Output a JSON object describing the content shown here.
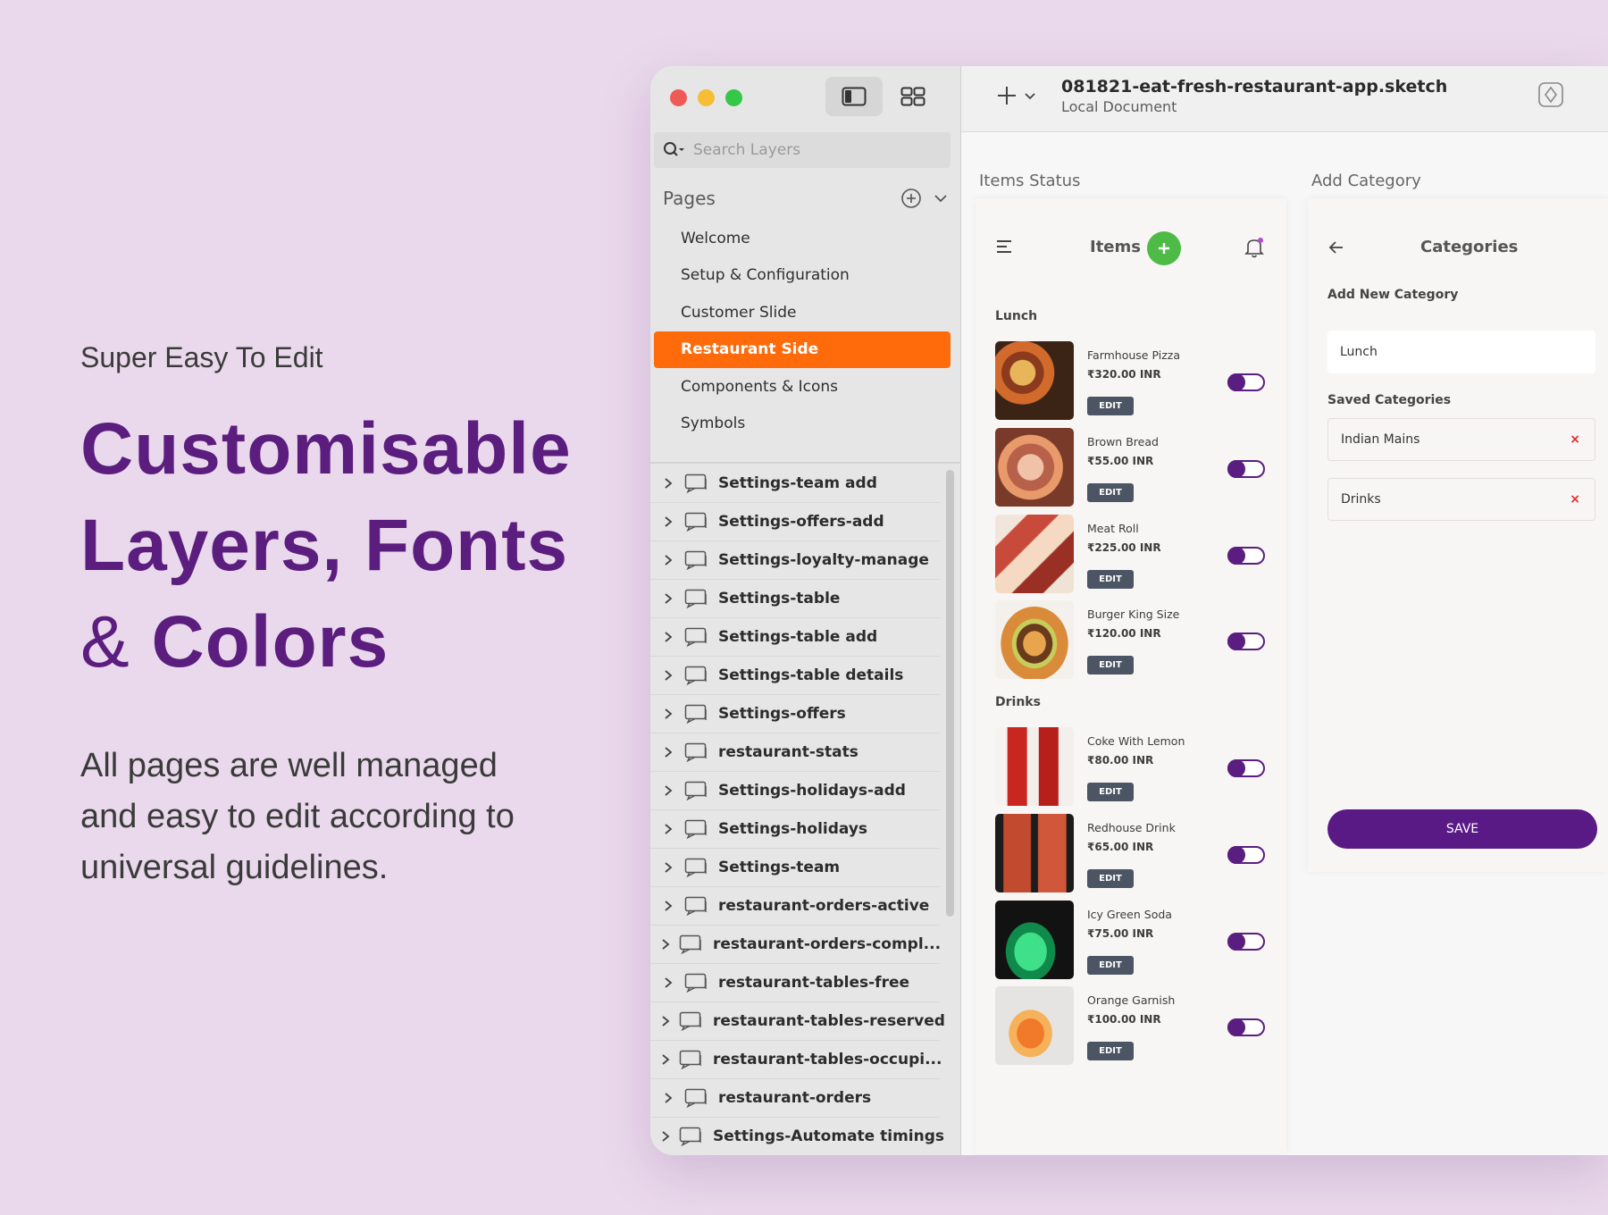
{
  "promo": {
    "eyebrow": "Super Easy To Edit",
    "headline_1": "Customisable",
    "headline_2": "Layers, Fonts",
    "headline_amp": "&",
    "headline_3": "Colors",
    "body_1": "All pages are well managed",
    "body_2": "and easy to edit according to",
    "body_3": "universal guidelines."
  },
  "sidebar": {
    "search_placeholder": "Search Layers",
    "pages_label": "Pages",
    "pages": [
      {
        "label": "Welcome"
      },
      {
        "label": "Setup & Configuration"
      },
      {
        "label": "Customer Slide"
      },
      {
        "label": "Restaurant Side",
        "active": true
      },
      {
        "label": "Components & Icons"
      },
      {
        "label": "Symbols"
      }
    ],
    "layers": [
      "Settings-team add",
      "Settings-offers-add",
      "Settings-loyalty-manage",
      "Settings-table",
      "Settings-table add",
      "Settings-table details",
      "Settings-offers",
      "restaurant-stats",
      "Settings-holidays-add",
      "Settings-holidays",
      "Settings-team",
      "restaurant-orders-active",
      "restaurant-orders-compl...",
      "restaurant-tables-free",
      "restaurant-tables-reserved",
      "restaurant-tables-occupi...",
      "restaurant-orders",
      "Settings-Automate timings"
    ]
  },
  "toolbar": {
    "doc_title": "081821-eat-fresh-restaurant-app.sketch",
    "doc_subtitle": "Local Document"
  },
  "canvas": {
    "items_artboard_label": "Items Status",
    "category_artboard_label": "Add Category"
  },
  "items_screen": {
    "title": "Items",
    "sections": [
      {
        "label": "Lunch",
        "items": [
          {
            "name": "Farmhouse Pizza",
            "price": "₹320.00 INR",
            "edit": "EDIT",
            "enabled": true
          },
          {
            "name": "Brown Bread",
            "price": "₹55.00 INR",
            "edit": "EDIT",
            "enabled": true
          },
          {
            "name": "Meat Roll",
            "price": "₹225.00 INR",
            "edit": "EDIT",
            "enabled": true
          },
          {
            "name": "Burger King Size",
            "price": "₹120.00 INR",
            "edit": "EDIT",
            "enabled": true
          }
        ]
      },
      {
        "label": "Drinks",
        "items": [
          {
            "name": "Coke With Lemon",
            "price": "₹80.00 INR",
            "edit": "EDIT",
            "enabled": true
          },
          {
            "name": "Redhouse Drink",
            "price": "₹65.00 INR",
            "edit": "EDIT",
            "enabled": true
          },
          {
            "name": "Icy Green Soda",
            "price": "₹75.00 INR",
            "edit": "EDIT",
            "enabled": true
          },
          {
            "name": "Orange Garnish",
            "price": "₹100.00 INR",
            "edit": "EDIT",
            "enabled": true
          }
        ]
      }
    ]
  },
  "category_screen": {
    "title": "Categories",
    "add_new_label": "Add New Category",
    "input_value": "Lunch",
    "saved_label": "Saved Categories",
    "saved": [
      {
        "name": "Indian Mains",
        "remove": "×"
      },
      {
        "name": "Drinks",
        "remove": "×"
      }
    ],
    "save_label": "SAVE"
  },
  "colors": {
    "accent_orange": "#ff6b0a",
    "brand_purple": "#5a1a86",
    "headline_purple": "#5b1d7e",
    "fab_green": "#4dbb45",
    "background": "#ead9ec"
  }
}
